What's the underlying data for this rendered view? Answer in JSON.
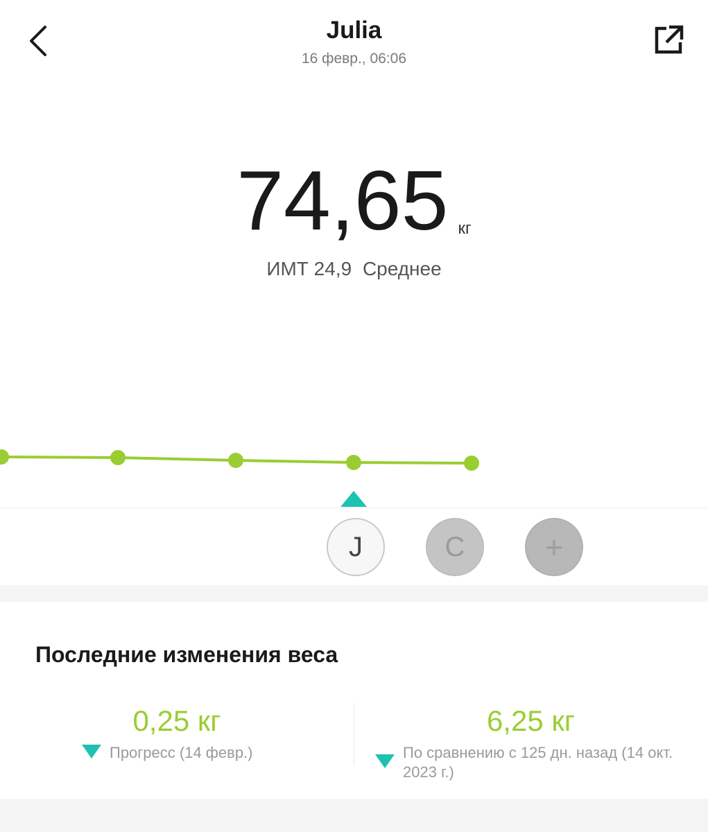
{
  "header": {
    "title": "Julia",
    "subtitle": "16 февр., 06:06"
  },
  "measurement": {
    "weight": "74,65",
    "unit": "кг",
    "bmi_label": "ИМТ 24,9",
    "bmi_status": "Среднее"
  },
  "chart_data": {
    "type": "line",
    "values": [
      null,
      null,
      null,
      null,
      74.65
    ],
    "note_values_unlabeled": true,
    "line_color": "#9acd32",
    "selected_index": 3
  },
  "users": [
    {
      "initial": "J",
      "selected": true
    },
    {
      "initial": "C",
      "selected": false
    },
    {
      "initial": "+",
      "selected": false
    }
  ],
  "changes": {
    "title": "Последние изменения веса",
    "left": {
      "value": "0,25 кг",
      "desc": "Прогресс (14 февр.)"
    },
    "right": {
      "value": "6,25 кг",
      "desc": "По сравнению с 125 дн. назад (14 окт. 2023 г.)"
    }
  },
  "colors": {
    "accent_green": "#9acd32",
    "accent_teal": "#1ec2b0"
  }
}
